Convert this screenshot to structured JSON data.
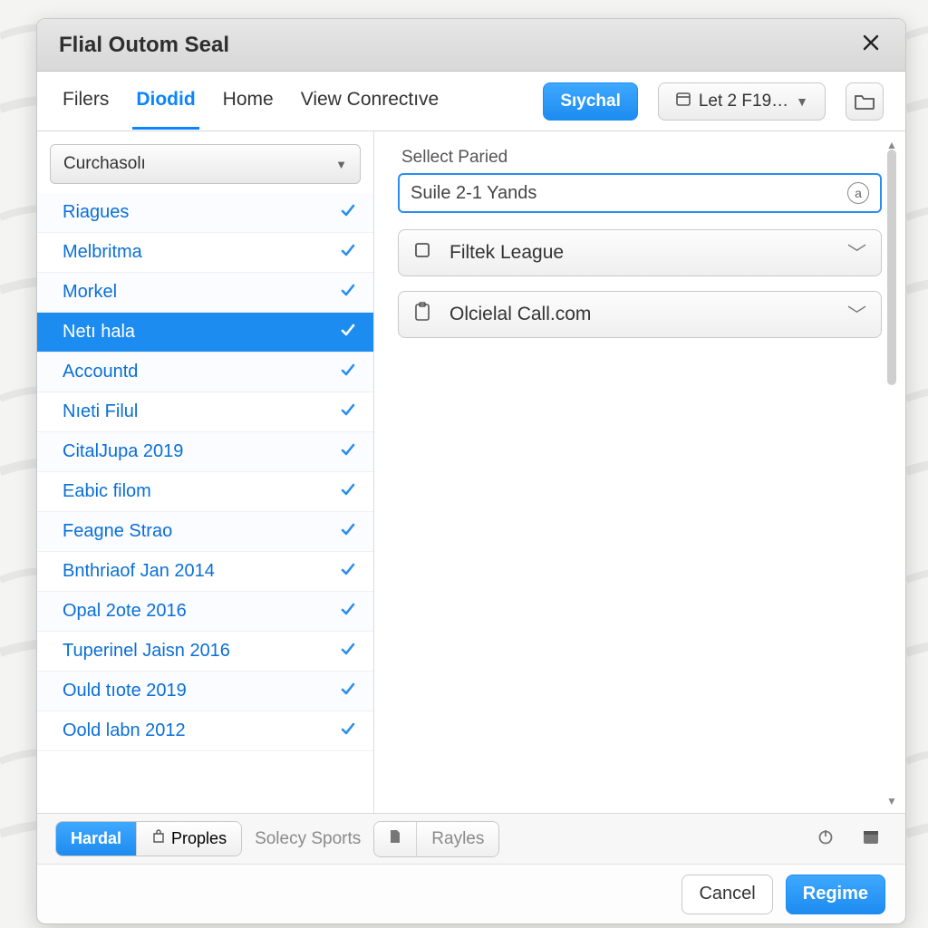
{
  "dialog": {
    "title": "Flial Outom Seal"
  },
  "tabs": {
    "items": [
      "Filers",
      "Diodid",
      "Home",
      "View Conrectıve"
    ],
    "activeIndex": 1
  },
  "toolbar": {
    "primary_button": "Sıychal",
    "date_dropdown": "Let 2 F19…"
  },
  "sidebar": {
    "dropdown": "Curchasolı",
    "items": [
      {
        "label": "Riagues"
      },
      {
        "label": "Melbritma"
      },
      {
        "label": "Morkel"
      },
      {
        "label": "Netı hala",
        "selected": true
      },
      {
        "label": "Accountd"
      },
      {
        "label": "Nıeti Filul"
      },
      {
        "label": "CitalJupa 2019"
      },
      {
        "label": "Eabic filom"
      },
      {
        "label": "Feagne Strao"
      },
      {
        "label": "Bnthriaof Jan 2014"
      },
      {
        "label": "Opal 2ote 2016"
      },
      {
        "label": "Tuperinel Jaisn 2016"
      },
      {
        "label": "Ould tıote 2019"
      },
      {
        "label": "Oold labn 2012"
      }
    ]
  },
  "main": {
    "label": "Sellect Paried",
    "search_value": "Suile 2-1 Yands",
    "picker1": "Filtek League",
    "picker2": "Olcielal Call.com"
  },
  "footer": {
    "seg1_active": "Hardal",
    "seg1_item": "Proples",
    "muted": "Solecy Sports",
    "seg2_item": "Rayles",
    "cancel": "Cancel",
    "submit": "Regime"
  }
}
